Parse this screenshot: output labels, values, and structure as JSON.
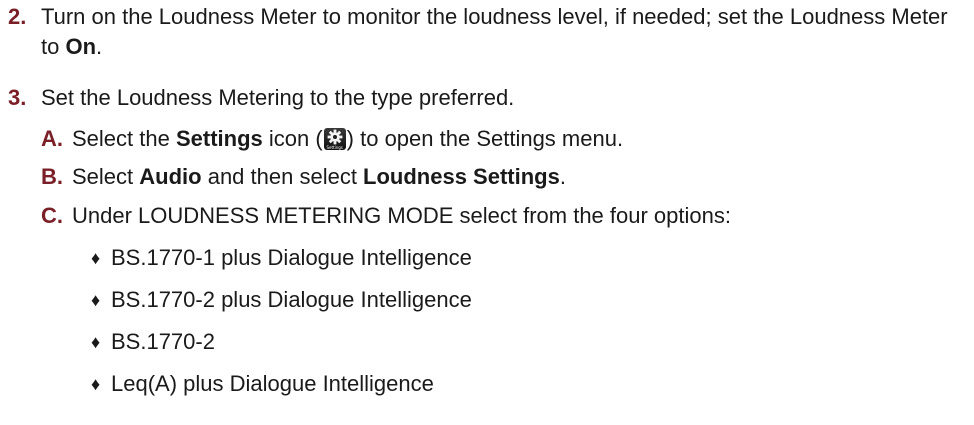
{
  "steps": [
    {
      "number": "2.",
      "text_before": "Turn on the Loudness Meter to monitor the loudness level, if needed; set the Loudness Meter to ",
      "bold": "On",
      "text_after": "."
    },
    {
      "number": "3.",
      "text": "Set the Loudness Metering to the type preferred."
    }
  ],
  "substeps": [
    {
      "letter": "A.",
      "t1": "Select the ",
      "b1": "Settings",
      "t2": " icon (",
      "icon": "settings-gear-icon",
      "icon_caption": "Settings",
      "t3": ") to open the Settings menu."
    },
    {
      "letter": "B.",
      "t1": "Select ",
      "b1": "Audio",
      "t2": " and then select ",
      "b2": "Loudness Settings",
      "t3": "."
    },
    {
      "letter": "C.",
      "text": "Under LOUDNESS METERING MODE select from the four options:"
    }
  ],
  "bullet_glyph": "♦",
  "options": [
    "BS.1770-1 plus Dialogue Intelligence",
    "BS.1770-2 plus Dialogue Intelligence",
    "BS.1770-2",
    "Leq(A) plus Dialogue Intelligence"
  ]
}
